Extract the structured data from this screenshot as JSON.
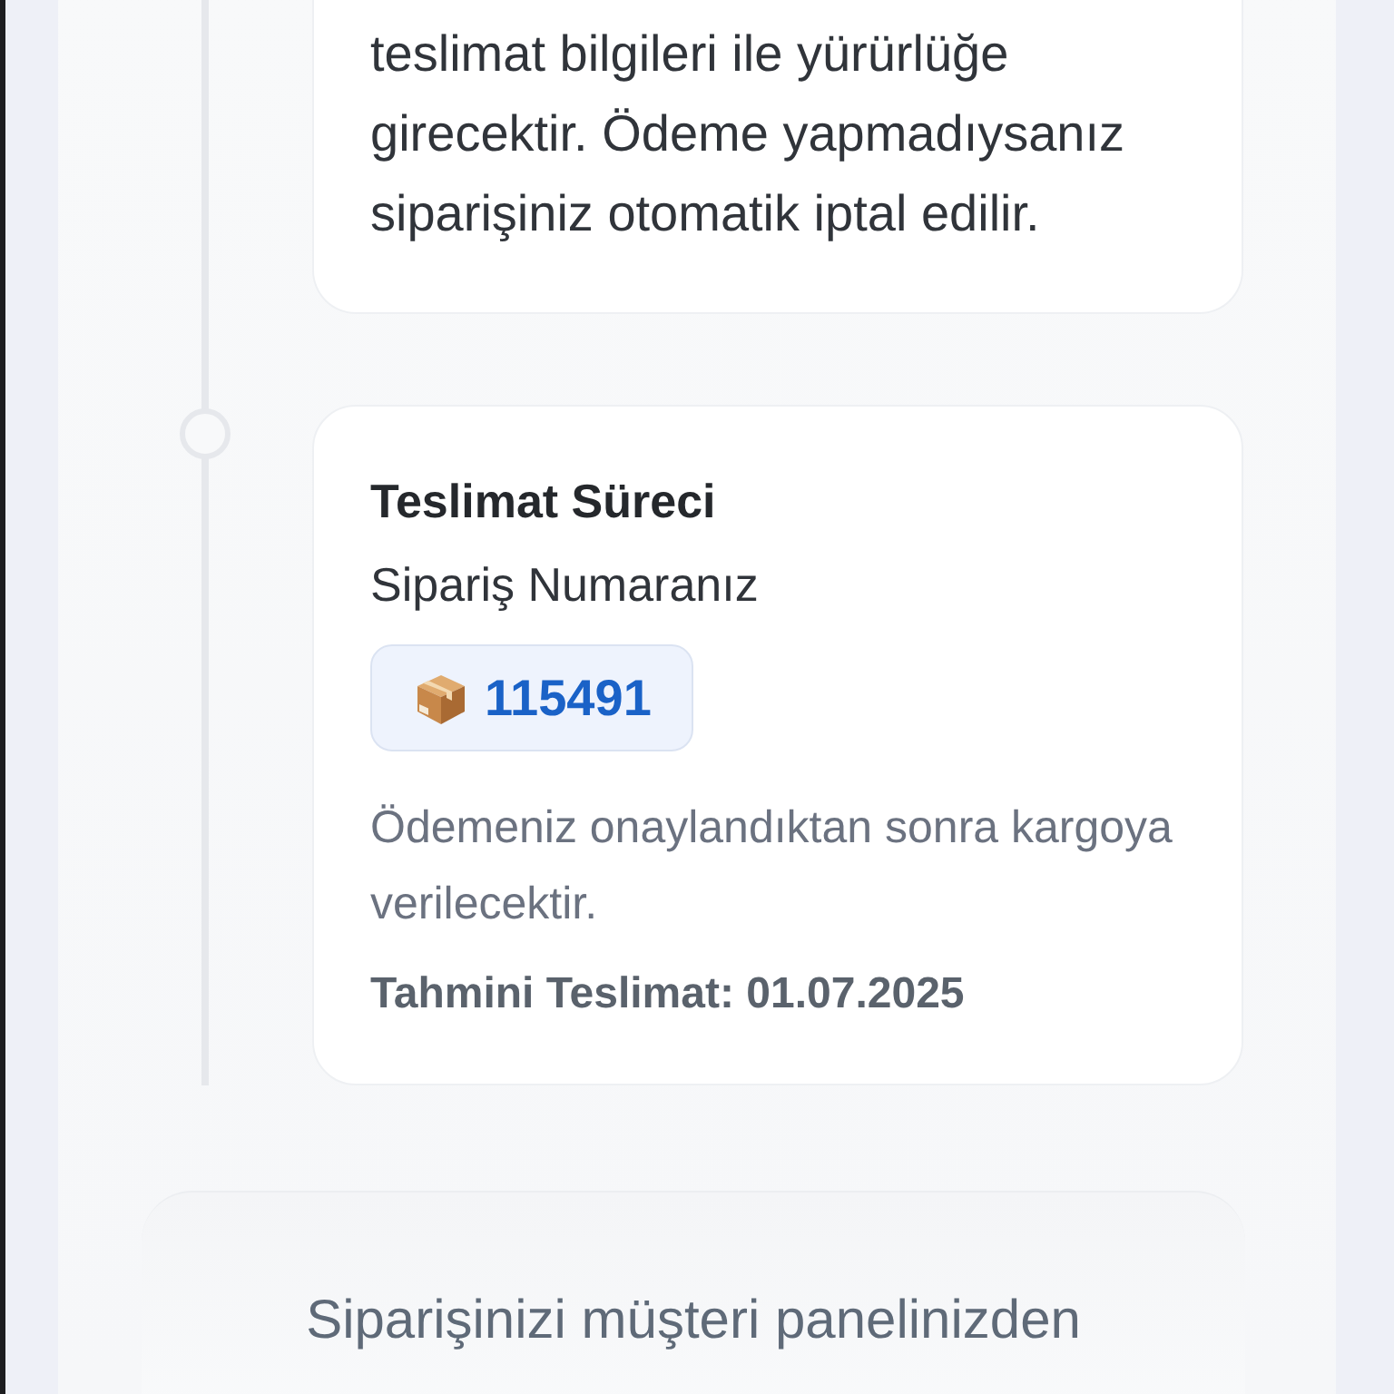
{
  "timeline": [
    {
      "kind": "partial",
      "text": "teslimat bilgileri ile yürürlüğe girecektir. Ödeme yapmadıysanız siparişiniz otomatik iptal edilir."
    },
    {
      "kind": "step",
      "title": "Teslimat Süreci",
      "subtitle": "Sipariş Numaranız",
      "order_number": "115491",
      "description": "Ödemeniz onaylandıktan sonra kargoya verilecektir.",
      "estimate": "Tahmini Teslimat: 01.07.2025"
    }
  ],
  "footer": {
    "text": "Siparişinizi müşteri panelinizden"
  }
}
